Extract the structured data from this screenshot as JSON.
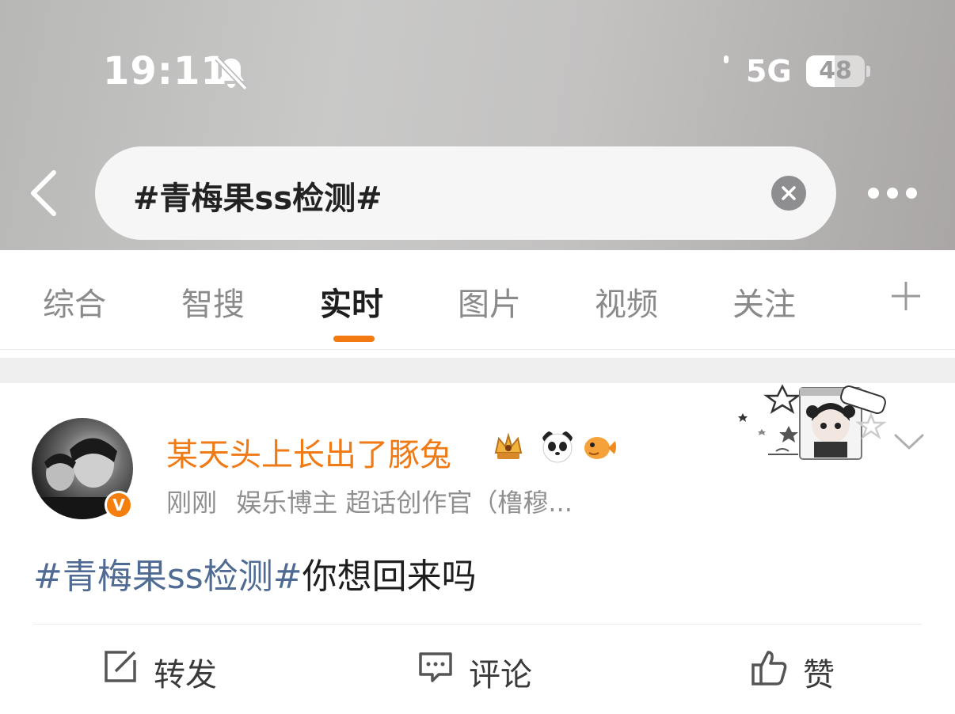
{
  "status_bar": {
    "time": "19:11",
    "network": "5G",
    "battery_level": "48",
    "battery_fraction": 0.48
  },
  "search": {
    "query": "#青梅果ss检测#"
  },
  "tabs": [
    {
      "label": "综合"
    },
    {
      "label": "智搜"
    },
    {
      "label": "实时",
      "active": true
    },
    {
      "label": "图片"
    },
    {
      "label": "视频"
    },
    {
      "label": "关注"
    }
  ],
  "post": {
    "username": "某天头上长出了豚兔",
    "avatar_badge": "V",
    "time_ago": "刚刚",
    "author_desc": "娱乐博主 超话创作官（橹穆...",
    "topic": "#青梅果ss检测#",
    "text": "你想回来吗",
    "actions": {
      "repost": "转发",
      "comment": "评论",
      "like": "赞"
    }
  },
  "icons": {
    "bell": "bell-slash-icon",
    "back": "chevron-left-icon",
    "clear": "close-circle-icon",
    "more": "more-icon",
    "add_tab": "plus-icon",
    "menu": "chevron-down-icon",
    "repost": "share-icon",
    "comment": "comment-icon",
    "like": "thumbs-up-icon"
  },
  "colors": {
    "accent": "#f37a12",
    "username": "#f07a15",
    "topic_link": "#4f6b94"
  }
}
